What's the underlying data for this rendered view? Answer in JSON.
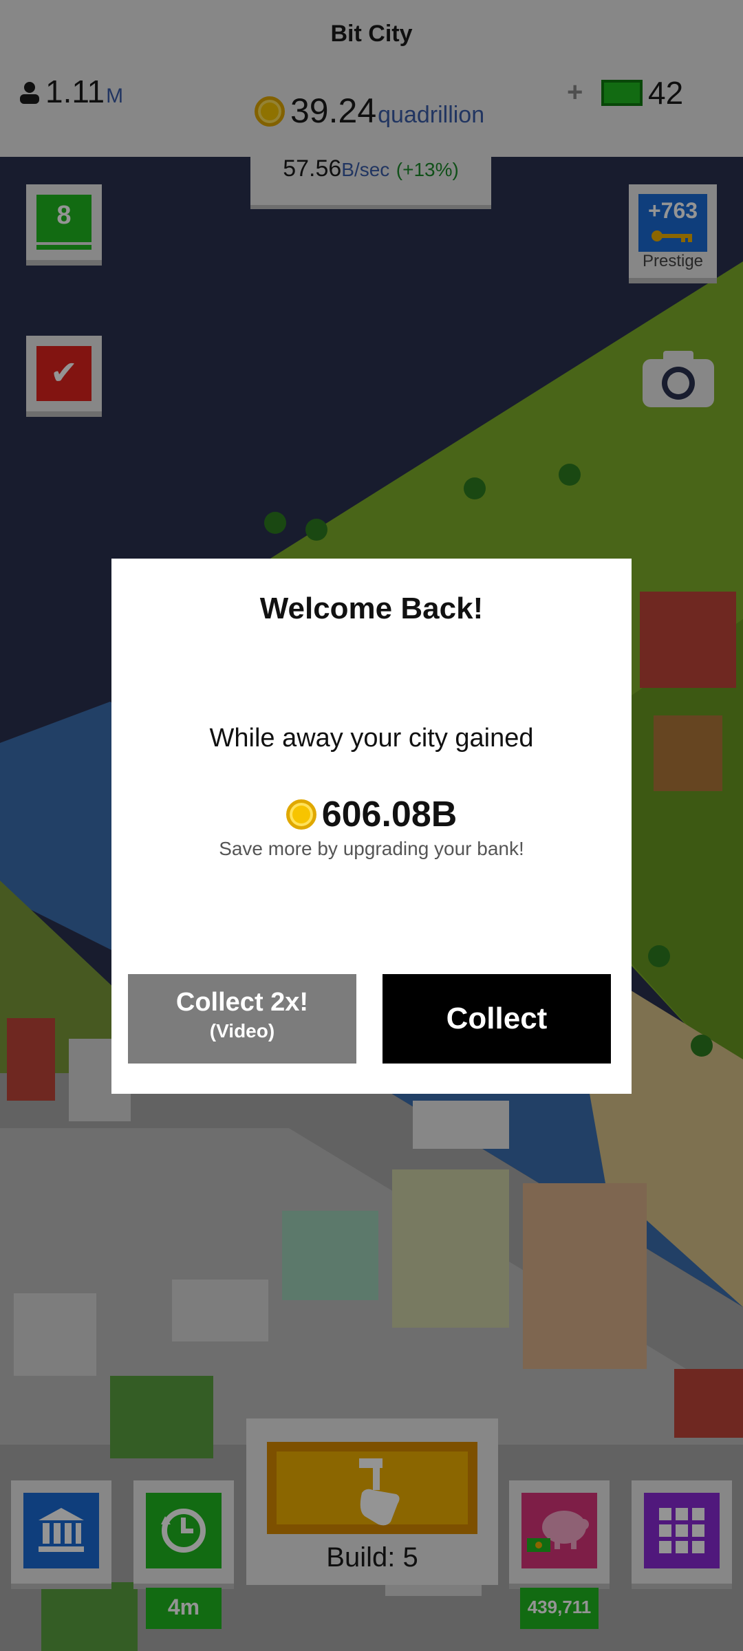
{
  "app": {
    "title": "Bit City"
  },
  "hud": {
    "population_value": "1.11",
    "population_unit": "M",
    "gold_value": "39.24",
    "gold_unit": "quadrillion",
    "cash_plus": "+",
    "cash_value": "42",
    "rate_value": "57.56",
    "rate_unit": "B/sec",
    "rate_bonus": "(+13%)"
  },
  "side": {
    "level": "8",
    "prestige_value": "+763",
    "prestige_label": "Prestige"
  },
  "dialog": {
    "title": "Welcome Back!",
    "message": "While away your city gained",
    "amount": "606.08B",
    "hint": "Save more by upgrading your bank!",
    "video_button_line1": "Collect 2x!",
    "video_button_line2": "(Video)",
    "collect_button": "Collect"
  },
  "toolbar": {
    "build_label": "Build: 5",
    "time_label": "4m",
    "cash_label": "439,711"
  },
  "icons": {
    "population": "person-icon",
    "gold": "coin-icon",
    "cash": "cash-icon",
    "tasks": "checkmark-icon",
    "prestige": "key-icon",
    "camera": "camera-icon",
    "bank": "bank-icon",
    "time": "clock-refresh-icon",
    "build": "hammer-hand-icon",
    "piggy": "piggy-bank-icon",
    "menu": "grid-icon"
  },
  "colors": {
    "green": "#1fb81f",
    "blue": "#1a6cd6",
    "red": "#e0231e",
    "purple": "#8a2ad6",
    "pink": "#d9347a",
    "yellow": "#f0b000",
    "accent_blue_text": "#3a5ca8"
  }
}
